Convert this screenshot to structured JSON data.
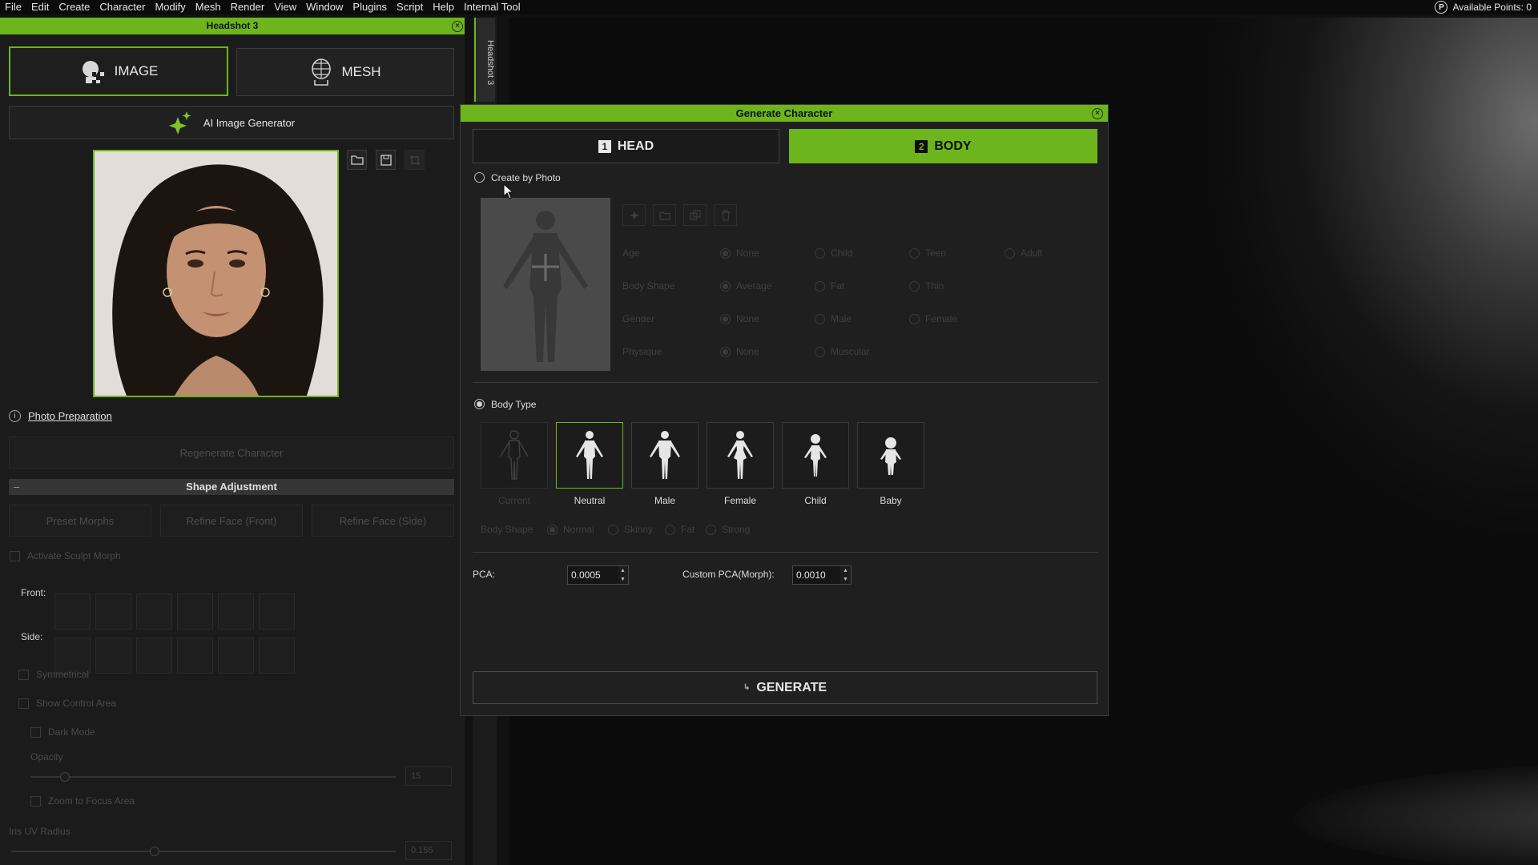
{
  "menubar": {
    "items": [
      "File",
      "Edit",
      "Create",
      "Character",
      "Modify",
      "Mesh",
      "Render",
      "View",
      "Window",
      "Plugins",
      "Script",
      "Help",
      "Internal Tool"
    ],
    "points_label": "Available Points: 0",
    "points_icon": "points-icon"
  },
  "left_panel": {
    "title": "Headshot 3",
    "vertical_tab": "Headshot 3",
    "mode_buttons": [
      "IMAGE",
      "MESH"
    ],
    "ai_generator_label": "AI Image Generator",
    "photo_preparation_label": "Photo Preparation",
    "regenerate_label": "Regenerate Character",
    "shape_adjustment": {
      "header": "Shape Adjustment",
      "buttons": [
        "Preset Morphs",
        "Refine Face (Front)",
        "Refine Face (Side)"
      ],
      "activate_sculpt": "Activate Sculpt Morph",
      "front_label": "Front:",
      "side_label": "Side:",
      "symmetrical": "Symmetrical",
      "show_control_area": "Show Control Area",
      "dark_mode": "Dark Mode",
      "opacity_label": "Opacity",
      "opacity_value": "15",
      "zoom_focus": "Zoom to Focus Area",
      "iris_label": "Iris UV Radius",
      "iris_value": "0.155"
    },
    "accent_color": "#6db51d"
  },
  "dialog": {
    "title": "Generate Character",
    "steps": [
      {
        "num": "1",
        "label": "HEAD"
      },
      {
        "num": "2",
        "label": "BODY"
      }
    ],
    "create_by_photo_label": "Create by Photo",
    "attributes": [
      {
        "label": "Age",
        "options": [
          "None",
          "Child",
          "Teen",
          "Adult"
        ]
      },
      {
        "label": "Body Shape",
        "options": [
          "Average",
          "Fat",
          "Thin"
        ]
      },
      {
        "label": "Gender",
        "options": [
          "None",
          "Male",
          "Female"
        ]
      },
      {
        "label": "Physique",
        "options": [
          "None",
          "Muscular"
        ]
      }
    ],
    "body_type_label": "Body Type",
    "body_types": [
      "Current",
      "Neutral",
      "Male",
      "Female",
      "Child",
      "Baby"
    ],
    "selected_body_type": "Neutral",
    "body_shape": {
      "label": "Body Shape",
      "options": [
        "Normal",
        "Skinny",
        "Fat",
        "Strong"
      ]
    },
    "pca_label": "PCA:",
    "pca_value": "0.0005",
    "custom_pca_label": "Custom PCA(Morph):",
    "custom_pca_value": "0.0010",
    "generate_label": "GENERATE"
  }
}
